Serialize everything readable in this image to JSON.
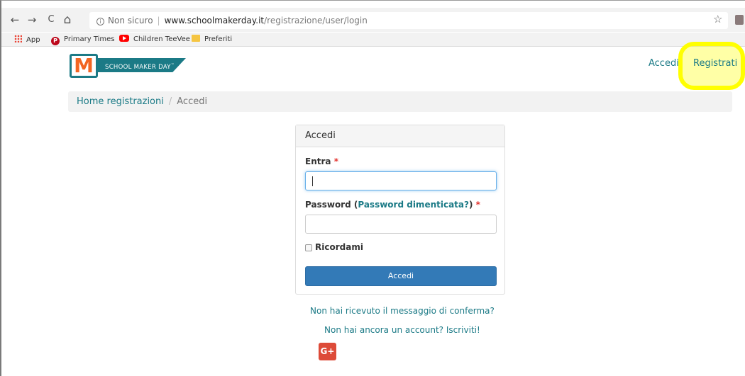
{
  "browser": {
    "back_glyph": "←",
    "forward_glyph": "→",
    "reload_glyph": "C",
    "home_glyph": "⌂",
    "info_glyph": "i",
    "security_label": "Non sicuro",
    "separator": "|",
    "url_host": "www.schoolmakerday.it",
    "url_path": "/registrazione/user/login",
    "star_glyph": "☆",
    "icons": {
      "back": "arrow-left-icon",
      "forward": "arrow-right-icon",
      "reload": "reload-icon",
      "home": "home-icon",
      "info": "info-icon",
      "star": "star-icon",
      "extension": "extension-icon"
    }
  },
  "bookmarks": {
    "items": [
      {
        "label": "App",
        "icon": "apps-grid-icon"
      },
      {
        "label": "Primary Times",
        "icon": "pinterest-icon"
      },
      {
        "label": "Children TeeVee",
        "icon": "youtube-icon"
      },
      {
        "label": "Preferiti",
        "icon": "folder-icon"
      }
    ],
    "pinterest_glyph": "P"
  },
  "site": {
    "logo_letter": "M",
    "logo_text": "SCHOOL MAKER DAY",
    "logo_tm": "™",
    "nav": {
      "login_label": "Accedi",
      "register_label": "Registrati"
    },
    "brand_color": "#1b7a86",
    "highlight_color": "#ffff00"
  },
  "breadcrumb": {
    "home": "Home registrazioni",
    "divider": "/",
    "current": "Accedi"
  },
  "login_panel": {
    "title": "Accedi",
    "username_label": "Entra",
    "required_marker": "*",
    "password_label_prefix": "Password (",
    "forgot_password_label": "Password dimenticata?",
    "password_label_suffix": ")",
    "username_value": "",
    "password_value": "",
    "remember_label": "Ricordami",
    "remember_checked": false,
    "submit_label": "Accedi",
    "primary_color": "#337ab7"
  },
  "links": {
    "resend_confirmation": "Non hai ricevuto il messaggio di conferma?",
    "signup": "Non hai ancora un account? Iscriviti!"
  },
  "social": {
    "google_plus_label": "G+",
    "google_plus_color": "#dd4b39",
    "icon": "google-plus-icon"
  }
}
